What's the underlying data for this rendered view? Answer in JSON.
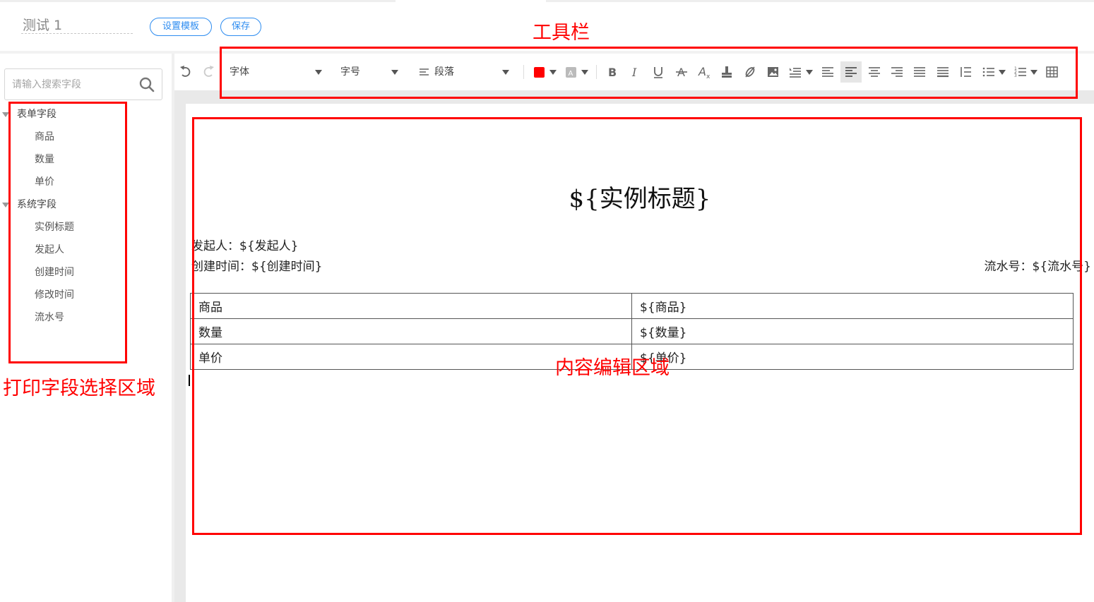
{
  "header": {
    "doc_title": "测试 1",
    "set_template_label": "设置模板",
    "save_label": "保存"
  },
  "sidebar": {
    "search_placeholder": "请输入搜索字段",
    "groups": [
      {
        "label": "表单字段",
        "items": [
          "商品",
          "数量",
          "单价"
        ]
      },
      {
        "label": "系统字段",
        "items": [
          "实例标题",
          "发起人",
          "创建时间",
          "修改时间",
          "流水号"
        ]
      }
    ]
  },
  "toolbar": {
    "font_family_label": "字体",
    "font_size_label": "字号",
    "paragraph_label": "段落",
    "text_color": "#ff0000",
    "bg_color": "#bbbbbb",
    "icons": [
      "undo-icon",
      "redo-icon",
      "bold-icon",
      "italic-icon",
      "underline-icon",
      "strikethrough-icon",
      "clear-format-icon",
      "format-painter-icon",
      "link-icon",
      "image-icon",
      "line-height-icon",
      "indent-icon",
      "align-left-icon",
      "align-center-icon",
      "align-right-icon",
      "align-justify-icon",
      "align-distribute-icon",
      "line-spacing-icon",
      "bullet-list-icon",
      "numbered-list-icon",
      "table-icon"
    ]
  },
  "document": {
    "heading": "${实例标题}",
    "initiator_line": "发起人：${发起人}",
    "created_line": "创建时间：${创建时间}",
    "serial_line": "流水号：${流水号}",
    "table": [
      [
        "商品",
        "${商品}"
      ],
      [
        "数量",
        "${数量}"
      ],
      [
        "单价",
        "${单价}"
      ]
    ]
  },
  "annotations": {
    "toolbar_label": "工具栏",
    "field_area_label": "打印字段选择区域",
    "content_area_label": "内容编辑区域",
    "color": "#ff0000"
  }
}
